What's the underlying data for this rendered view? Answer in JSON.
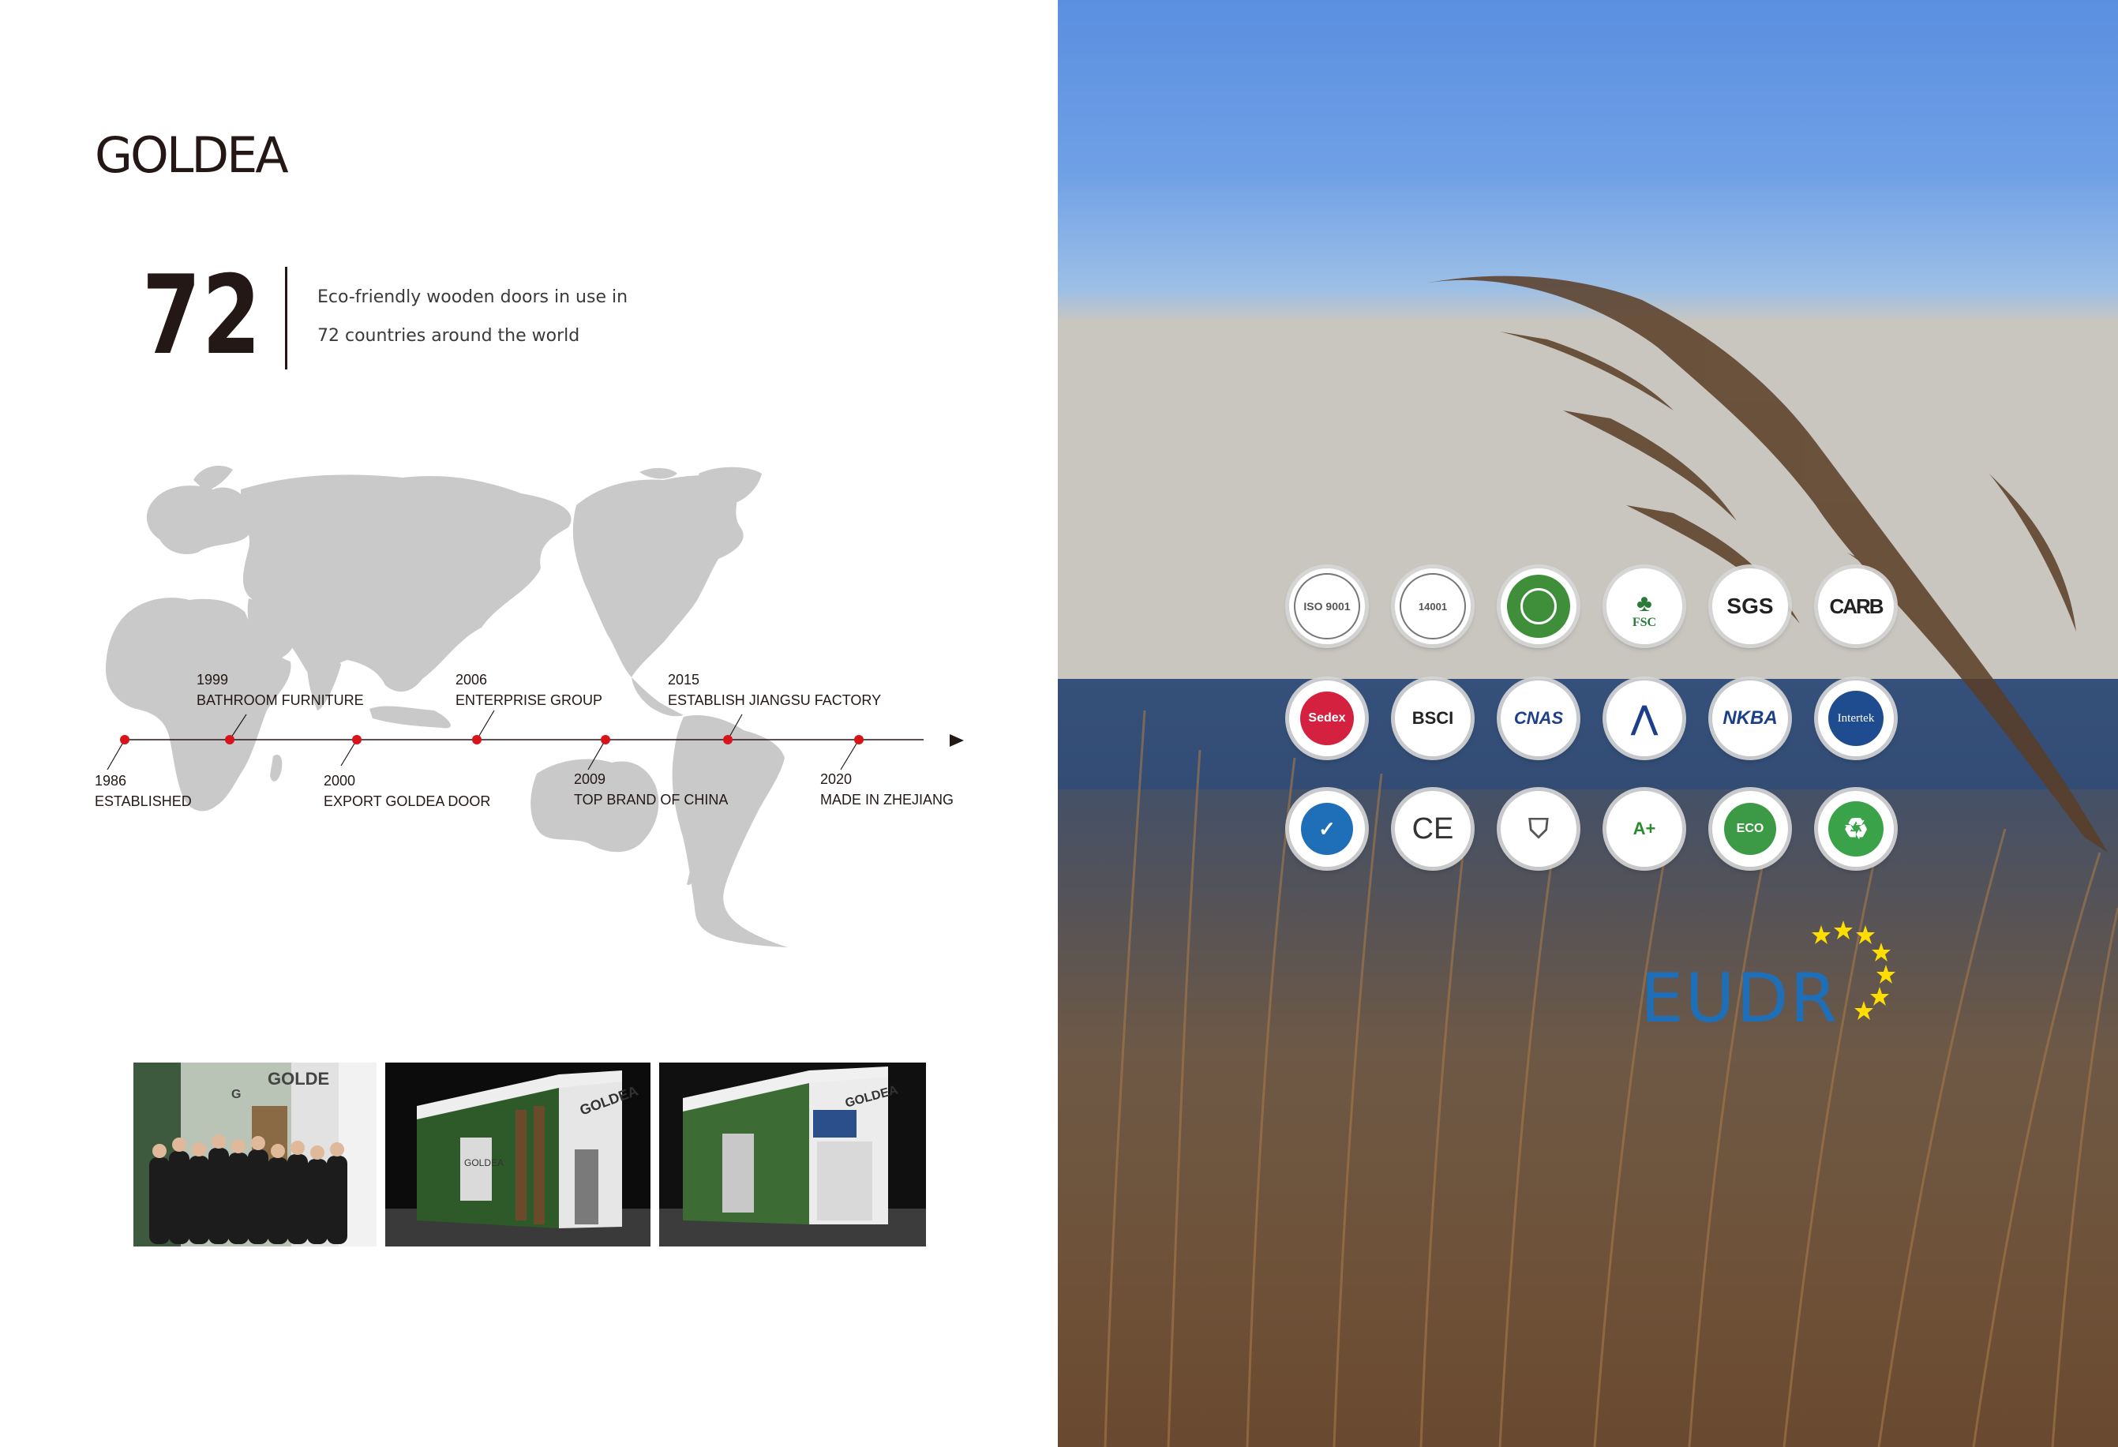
{
  "brand": {
    "name": "GOLDEA"
  },
  "highlight": {
    "number": "72",
    "line1": "Eco-friendly wooden doors in use in",
    "line2": "72 countries around the world"
  },
  "timeline": [
    {
      "year": "1986",
      "label": "ESTABLISHED"
    },
    {
      "year": "1999",
      "label": "BATHROOM FURNITURE"
    },
    {
      "year": "2000",
      "label": "EXPORT GOLDEA DOOR"
    },
    {
      "year": "2006",
      "label": "ENTERPRISE GROUP"
    },
    {
      "year": "2009",
      "label": "TOP BRAND OF CHINA"
    },
    {
      "year": "2015",
      "label": "ESTABLISH JIANGSU FACTORY"
    },
    {
      "year": "2020",
      "label": "MADE IN ZHEJIANG"
    }
  ],
  "photos": {
    "team_sign": "GOLDE",
    "team_sign_small": "G",
    "booth1_sign": "GOLDEA",
    "booth1_panel": "GOLDEA",
    "booth2_sign": "GOLDEA"
  },
  "certifications": {
    "row1": [
      "ISO 9001",
      "14001",
      "",
      "FSC",
      "SGS",
      "CARB"
    ],
    "row2": [
      "Sedex",
      "BSCI",
      "CNAS",
      "",
      "NKBA",
      "Intertek"
    ],
    "row3": [
      "",
      "CE",
      "",
      "A+",
      "ECO",
      ""
    ],
    "icons": {
      "row1": [
        "iso-9001-icon",
        "iso-14001-icon",
        "china-environmental-label-icon",
        "fsc-tree-icon",
        "sgs-icon",
        "carb-icon"
      ],
      "row2": [
        "sedex-icon",
        "bsci-icon",
        "cnas-icon",
        "accreditation-icon",
        "nkba-icon",
        "intertek-icon"
      ],
      "row3": [
        "quality-check-icon",
        "ce-icon",
        "shield-mark-icon",
        "energy-a-plus-icon",
        "eco-leaf-icon",
        "recycle-icon"
      ]
    }
  },
  "eudr": {
    "text": "EUDR"
  },
  "colors": {
    "ink": "#231815",
    "map_gray": "#c9c9c9",
    "timeline_dot": "#d7141a",
    "eudr_blue": "#1e6fb8",
    "eu_star": "#ffdd00"
  }
}
